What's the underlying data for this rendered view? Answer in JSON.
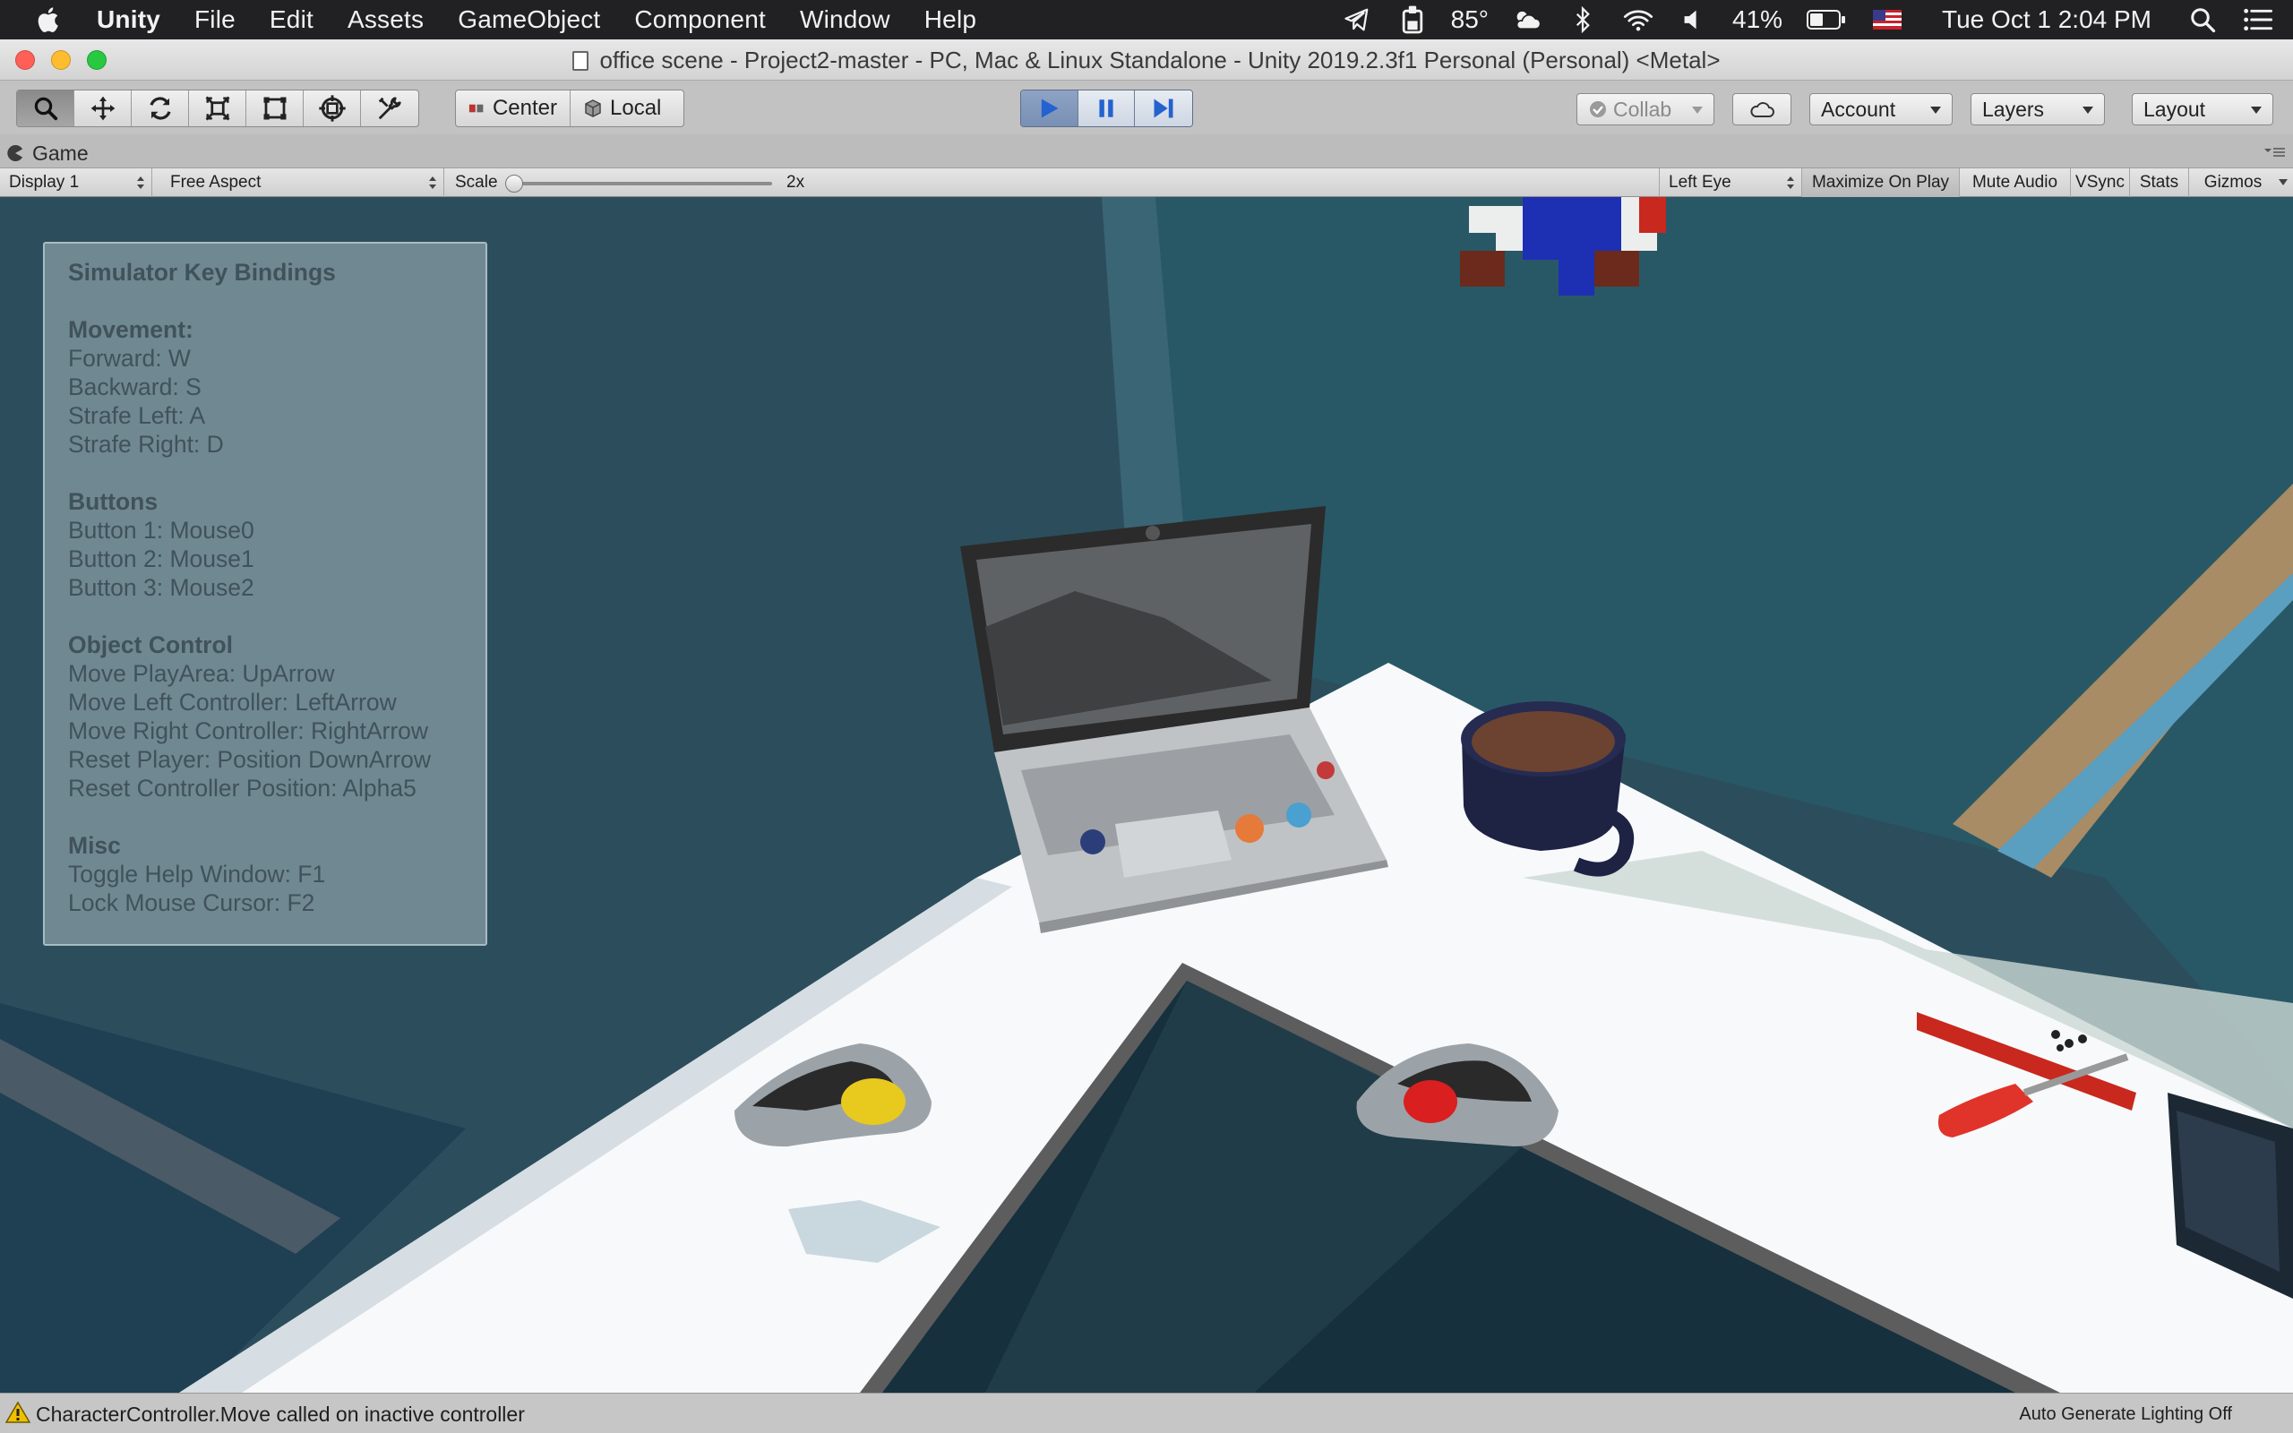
{
  "menubar": {
    "app_name": "Unity",
    "items": [
      "File",
      "Edit",
      "Assets",
      "GameObject",
      "Component",
      "Window",
      "Help"
    ],
    "temperature": "85°",
    "battery": "41%",
    "datetime": "Tue Oct 1  2:04 PM",
    "status_icons": [
      "telegram-icon",
      "clipboard-icon",
      "weather-icon",
      "bluetooth-icon",
      "wifi-icon",
      "volume-icon",
      "battery-icon",
      "flag-icon",
      "search-icon",
      "list-icon"
    ]
  },
  "window": {
    "title": "office scene - Project2-master - PC, Mac & Linux Standalone - Unity 2019.2.3f1 Personal (Personal) <Metal>",
    "traffic_colors": [
      "#ff5f57",
      "#febc2e",
      "#28c840"
    ]
  },
  "toolbar": {
    "tools": [
      "hand-tool-icon",
      "move-tool-icon",
      "rotate-tool-icon",
      "scale-tool-icon",
      "rect-tool-icon",
      "transform-tool-icon",
      "custom-tool-icon"
    ],
    "pivot_label": "Center",
    "space_label": "Local",
    "collab_label": "Collab",
    "account_label": "Account",
    "layers_label": "Layers",
    "layout_label": "Layout",
    "play_accent": "#2462d0"
  },
  "game": {
    "tab_label": "Game",
    "display": "Display 1",
    "aspect": "Free Aspect",
    "scale_label": "Scale",
    "scale_value": "2x",
    "eye": "Left Eye",
    "toggles": [
      "Maximize On Play",
      "Mute Audio",
      "VSync",
      "Stats",
      "Gizmos"
    ]
  },
  "help": {
    "title": "Simulator Key Bindings",
    "sections": [
      {
        "heading": "Movement:",
        "lines": [
          "Forward: W",
          "Backward: S",
          "Strafe Left: A",
          "Strafe Right: D"
        ]
      },
      {
        "heading": "Buttons",
        "lines": [
          "Button 1: Mouse0",
          "Button 2: Mouse1",
          "Button 3: Mouse2"
        ]
      },
      {
        "heading": "Object Control",
        "lines": [
          "Move PlayArea: UpArrow",
          "Move Left Controller: LeftArrow",
          "Move Right Controller: RightArrow",
          "Reset Player: Position DownArrow",
          "Reset Controller Position: Alpha5"
        ]
      },
      {
        "heading": "Misc",
        "lines": [
          "Toggle Help Window: F1",
          "Lock Mouse Cursor: F2"
        ]
      }
    ]
  },
  "status": {
    "message": "CharacterController.Move called on inactive controller",
    "right": "Auto Generate Lighting Off"
  }
}
